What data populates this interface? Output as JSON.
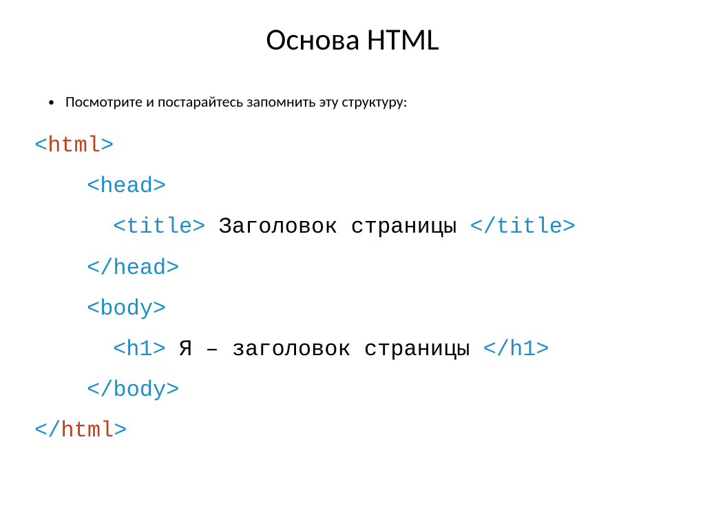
{
  "slide": {
    "title": "Основа HTML",
    "bullet_text": "Посмотрите и постарайтесь запомнить эту структуру:",
    "code": {
      "l1": {
        "open_angle": "<",
        "tag": "html",
        "close_angle": ">"
      },
      "l2": {
        "open_angle": "<",
        "tag": "head",
        "close_angle": ">"
      },
      "l3": {
        "open_a": "<",
        "tag_a": "title",
        "close_a": ">",
        "text": " Заголовок страницы ",
        "open_b": "</",
        "tag_b": "title",
        "close_b": ">"
      },
      "l4": {
        "open_angle": "</",
        "tag": "head",
        "close_angle": ">"
      },
      "l5": {
        "open_angle": "<",
        "tag": "body",
        "close_angle": ">"
      },
      "l6": {
        "open_a": "<",
        "tag_a": "h1",
        "close_a": ">",
        "text": " Я – заголовок страницы ",
        "open_b": "</",
        "tag_b": "h1",
        "close_b": ">"
      },
      "l7": {
        "open_angle": "</",
        "tag": "body",
        "close_angle": ">"
      },
      "l8": {
        "open_angle": "</",
        "tag": "html",
        "close_angle": ">"
      }
    }
  }
}
